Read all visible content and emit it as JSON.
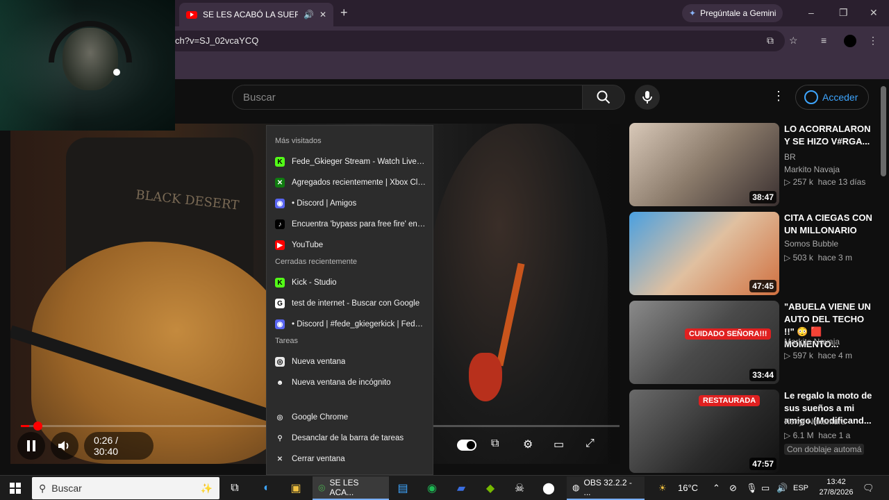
{
  "browser": {
    "tab_title": "SE LES ACABÓ LA SUERTE E",
    "new_tab": "+",
    "gemini_label": "Pregúntale a Gemini",
    "url": "ch?v=SJ_02vcaYCQ",
    "window_controls": [
      "–",
      "❐",
      "✕"
    ]
  },
  "youtube": {
    "search_placeholder": "Buscar",
    "login_label": "Acceder",
    "more_icon": "⋮"
  },
  "player": {
    "current_time": "0:26",
    "time_separator": " / ",
    "duration": "30:40",
    "progress_fraction": 0.014,
    "chair_brand": "BLACK DESERT"
  },
  "jump_list": {
    "sections": [
      {
        "heading": "Más visitados",
        "items": [
          {
            "label": "Fede_Gkieger Stream - Watch Live on...",
            "icon": "kick-icon",
            "color": "#53fc18",
            "glyph": "K"
          },
          {
            "label": "Agregados recientemente | Xbox Clou...",
            "icon": "xbox-icon",
            "color": "#107c10",
            "glyph": "✕"
          },
          {
            "label": "• Discord | Amigos",
            "icon": "discord-icon",
            "color": "#5865f2",
            "glyph": "◉"
          },
          {
            "label": "Encuentra 'bypass para free fire' en Tik...",
            "icon": "tiktok-icon",
            "color": "#000000",
            "glyph": "♪"
          },
          {
            "label": "YouTube",
            "icon": "youtube-icon",
            "color": "#ff0000",
            "glyph": "▶"
          }
        ]
      },
      {
        "heading": "Cerradas recientemente",
        "items": [
          {
            "label": "Kick - Studio",
            "icon": "kick-icon",
            "color": "#53fc18",
            "glyph": "K"
          },
          {
            "label": "test de internet - Buscar con Google",
            "icon": "google-icon",
            "color": "#ffffff",
            "glyph": "G"
          },
          {
            "label": "• Discord | #fede_gkiegerkick | Fede_g...",
            "icon": "discord-icon",
            "color": "#5865f2",
            "glyph": "◉"
          }
        ]
      },
      {
        "heading": "Tareas",
        "items": [
          {
            "label": "Nueva ventana",
            "icon": "chrome-icon",
            "color": "#e8e8e8",
            "glyph": "◎"
          },
          {
            "label": "Nueva ventana de incógnito",
            "icon": "incognito-icon",
            "color": "#2c2c2c",
            "glyph": "☻"
          }
        ]
      }
    ],
    "footer": [
      {
        "label": "Google Chrome",
        "icon": "chrome-icon",
        "glyph": "◎"
      },
      {
        "label": "Desanclar de la barra de tareas",
        "icon": "unpin-icon",
        "glyph": "⚲"
      },
      {
        "label": "Cerrar ventana",
        "icon": "close-icon",
        "glyph": "✕"
      }
    ]
  },
  "recommendations": [
    {
      "title": "LO ACORRALARON Y SE HIZO V#RGA...",
      "channel": "BR",
      "channel_extra": "Markito Navaja",
      "views": "257 k",
      "age": "hace 13 días",
      "duration": "38:47",
      "bg": "linear-gradient(135deg,#d8c8b8,#8a7a6a 50%,#3a3030)"
    },
    {
      "title": "CITA A CIEGAS CON UN MILLONARIO",
      "channel": "Somos Bubble",
      "channel_extra": "",
      "views": "503 k",
      "age": "hace 3 m",
      "duration": "47:45",
      "bg": "linear-gradient(135deg,#4aa0e0,#e0c0a0 50%,#d07040)"
    },
    {
      "title": "\"ABUELA VIENE UN AUTO DEL TECHO !!\" 😳 🟥 MOMENTO...",
      "channel": "Markito Navaja",
      "channel_extra": "",
      "views": "597 k",
      "age": "hace 4 m",
      "duration": "33:44",
      "bg": "linear-gradient(135deg,#8a8a8a,#4a4a4a 50%,#2a2a2a)",
      "tag": "CUIDADO SEÑORA!!!"
    },
    {
      "title": "Le regalo la moto de sus sueños a mi amigo (Modificand...",
      "channel": "Kenyi Nakamura",
      "channel_extra": "",
      "views": "6.1 M",
      "age": "hace 1 a",
      "duration": "47:57",
      "bg": "linear-gradient(135deg,#6a6a6a,#2a2a2a 60%,#111)",
      "tag": "RESTAURADA",
      "dub": "Con doblaje automá"
    }
  ],
  "taskbar": {
    "search_placeholder": "Buscar",
    "active_app": "SE LES ACA...",
    "obs_label": "OBS 32.2.2 - ...",
    "weather": "16°C",
    "lang": "ESP",
    "time": "13:42",
    "date": "27/8/2026"
  }
}
